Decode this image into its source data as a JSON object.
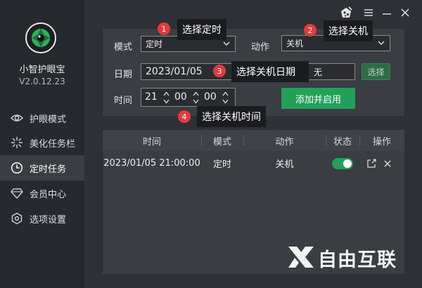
{
  "app": {
    "name": "小智护眼宝",
    "version": "V2.0.12.23",
    "logo_icon": "eye-lens-logo"
  },
  "sidebar": {
    "items": [
      {
        "label": "护眼模式",
        "icon": "eye-icon",
        "active": false
      },
      {
        "label": "美化任务栏",
        "icon": "sparkle-icon",
        "active": false
      },
      {
        "label": "定时任务",
        "icon": "clock-icon",
        "active": true
      },
      {
        "label": "会员中心",
        "icon": "diamond-icon",
        "active": false
      },
      {
        "label": "选项设置",
        "icon": "settings-icon",
        "active": false
      }
    ]
  },
  "window_controls": {
    "icons": [
      "skin-icon",
      "menu-icon",
      "minimize-icon",
      "close-icon"
    ]
  },
  "form": {
    "mode_label": "模式",
    "mode_value": "定时",
    "action_label": "动作",
    "action_value": "关机",
    "date_label": "日期",
    "date_value": "2023/01/05",
    "repeat_value": "无",
    "select_button": "选择",
    "time_label": "时间",
    "hour": "21",
    "minute": "00",
    "second": "00",
    "add_button": "添加并启用"
  },
  "callouts": [
    {
      "number": "1",
      "text": "选择定时"
    },
    {
      "number": "2",
      "text": "选择关机"
    },
    {
      "number": "3",
      "text": "选择关机日期"
    },
    {
      "number": "4",
      "text": "选择关机时间"
    }
  ],
  "table": {
    "headers": [
      "时间",
      "模式",
      "动作",
      "状态",
      "操作"
    ],
    "rows": [
      {
        "time": "2023/01/05 21:00:00",
        "mode": "定时",
        "action": "关机",
        "status": true
      }
    ]
  },
  "watermark": {
    "text": "自由互联"
  },
  "colors": {
    "accent_green": "#22a05a",
    "badge_red": "#e23b3b",
    "background": "#2d3035",
    "sidebar": "#26292d",
    "panel": "#3a3d42"
  }
}
